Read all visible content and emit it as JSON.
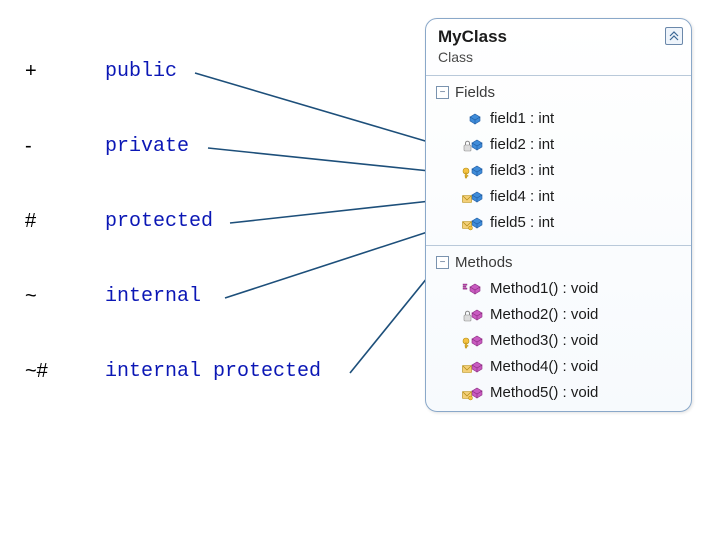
{
  "legend": {
    "rows": [
      {
        "symbol": "+",
        "label": "public"
      },
      {
        "symbol": "-",
        "label": "private"
      },
      {
        "symbol": "#",
        "label": "protected"
      },
      {
        "symbol": "~",
        "label": "internal"
      },
      {
        "symbol": "~#",
        "label": "internal protected"
      }
    ]
  },
  "class": {
    "name": "MyClass",
    "stereotype": "Class",
    "sections": {
      "fields": {
        "title": "Fields",
        "members": [
          {
            "icon": "field-public-icon",
            "text": "field1 : int"
          },
          {
            "icon": "field-private-icon",
            "text": "field2 : int"
          },
          {
            "icon": "field-protected-icon",
            "text": "field3 : int"
          },
          {
            "icon": "field-internal-icon",
            "text": "field4 : int"
          },
          {
            "icon": "field-ip-icon",
            "text": "field5 : int"
          }
        ]
      },
      "methods": {
        "title": "Methods",
        "members": [
          {
            "icon": "method-public-icon",
            "text": "Method1() : void"
          },
          {
            "icon": "method-private-icon",
            "text": "Method2() : void"
          },
          {
            "icon": "method-protected-icon",
            "text": "Method3() : void"
          },
          {
            "icon": "method-internal-icon",
            "text": "Method4() : void"
          },
          {
            "icon": "method-ip-icon",
            "text": "Method5() : void"
          }
        ]
      }
    }
  },
  "expander_glyph": "−"
}
